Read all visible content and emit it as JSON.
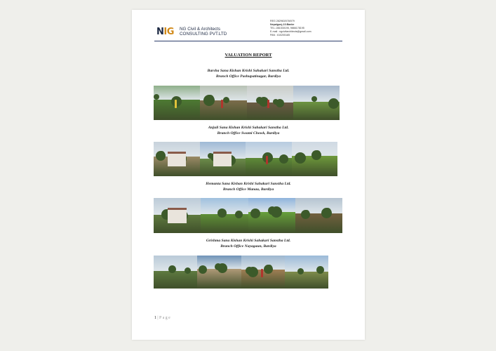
{
  "header": {
    "logo_text_a": "N",
    "logo_text_b": "IG",
    "company_line1": "NG Civil & Architects",
    "company_line2": "CONSULTING PVT.LTD",
    "contact": [
      {
        "text": "REG 282963/078/079",
        "strong": false
      },
      {
        "text": "Nepalgunj-10.Banke",
        "strong": true
      },
      {
        "text": "TEL:-081530195, 9866178195",
        "strong": false
      },
      {
        "text": "E-mail : ngcivilarchitects@gmail.com",
        "strong": false
      },
      {
        "text": "PAN : 610205185",
        "strong": false
      }
    ]
  },
  "title": "VALUATION REPORT",
  "offices": [
    {
      "name": "Barsha Sana Kishan Krishi Sahakari Sanstha Ltd.",
      "branch": "Branch Office Pashupatinagar, Bardiya",
      "photos": [
        {
          "scene": "tree-field-with-person",
          "sky": "#8fb08a",
          "ground": "#4d7a33"
        },
        {
          "scene": "field-with-person",
          "sky": "#b8c2b5",
          "ground": "#7c6d4b"
        },
        {
          "scene": "dirt-road-with-people",
          "sky": "#c9ccc8",
          "ground": "#6b5a44"
        },
        {
          "scene": "paddy-field",
          "sky": "#a8b9cc",
          "ground": "#6d9442"
        }
      ]
    },
    {
      "name": "Anjuli Sana Kishan Krishi Sahakari Sanstha Ltd.",
      "branch": "Branch Office Swami Chowk, Bardiya",
      "photos": [
        {
          "scene": "house-with-trees",
          "sky": "#c7d2dc",
          "ground": "#9b8a66"
        },
        {
          "scene": "small-building",
          "sky": "#9fb9d6",
          "ground": "#6b8a49"
        },
        {
          "scene": "field-with-person",
          "sky": "#b7cbe0",
          "ground": "#5e8a38"
        },
        {
          "scene": "open-field-trees",
          "sky": "#cfd9e3",
          "ground": "#6f9a3c"
        }
      ]
    },
    {
      "name": "Hemanta Sana Kishan Krishi Sahakari Sanstha Ltd.",
      "branch": "Branch Office Manau, Bardiya",
      "photos": [
        {
          "scene": "house-with-trees",
          "sky": "#bccbd8",
          "ground": "#5f7a3f"
        },
        {
          "scene": "canal-field",
          "sky": "#9fc0de",
          "ground": "#5f8f37"
        },
        {
          "scene": "green-field",
          "sky": "#8fb4dc",
          "ground": "#67a03c"
        },
        {
          "scene": "field-path",
          "sky": "#b5c4d1",
          "ground": "#72603f"
        }
      ]
    },
    {
      "name": "Grishma Sana Kishan Krishi Sahakari Sanstha Ltd.",
      "branch": "Branch Office Nayagaun, Bardiya",
      "photos": [
        {
          "scene": "tree-field",
          "sky": "#b9cad8",
          "ground": "#5e7a40"
        },
        {
          "scene": "dry-land",
          "sky": "#6f93b8",
          "ground": "#b09a78"
        },
        {
          "scene": "dry-land-person",
          "sky": "#9cb6cf",
          "ground": "#a07f55"
        },
        {
          "scene": "field-trees",
          "sky": "#9bbad8",
          "ground": "#7e8c4c"
        }
      ]
    }
  ],
  "footer": {
    "page_number": "1",
    "separator": "|",
    "page_word": "Page"
  }
}
